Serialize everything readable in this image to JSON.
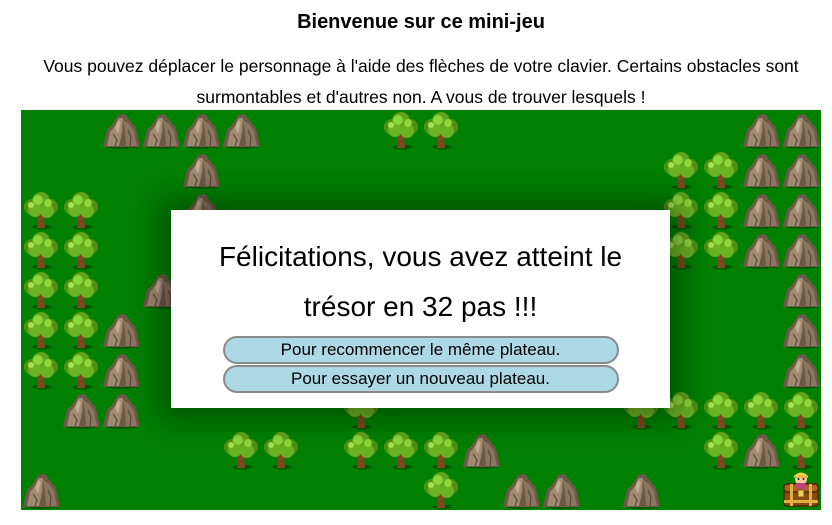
{
  "page": {
    "title": "Bienvenue sur ce mini-jeu",
    "intro": "Vous pouvez déplacer le personnage à l'aide des flèches de votre clavier. Certains obstacles sont surmontables et d'autres non. A vous de trouver lesquels !"
  },
  "board": {
    "columns": 20,
    "rows": 10,
    "background_color": "#008000",
    "legend": {
      "R": "rock",
      "T": "tree",
      "C": "treasure-chest",
      "P": "player"
    },
    "grid": [
      "..RRRR...TT.......RR",
      "....R...........TTRR",
      "TT..R...........TTRR",
      "TT..R...........TTRR",
      "TT.R...............R",
      "TTR................R",
      "TTR................R",
      ".RR.....T......TTTTT",
      ".....TT.TTTR.....TRT",
      "R.........T.RR.R...C"
    ]
  },
  "dialog": {
    "message": "Félicitations, vous avez atteint le trésor en 32 pas !!!",
    "restart_same_label": "Pour recommencer le même plateau.",
    "new_board_label": "Pour essayer un nouveau plateau."
  },
  "colors": {
    "grass": "#008000",
    "button_bg": "#add8e6",
    "button_border": "#8a8a8a",
    "rock": "#8b7560",
    "tree_leaves": "#7dc829"
  }
}
